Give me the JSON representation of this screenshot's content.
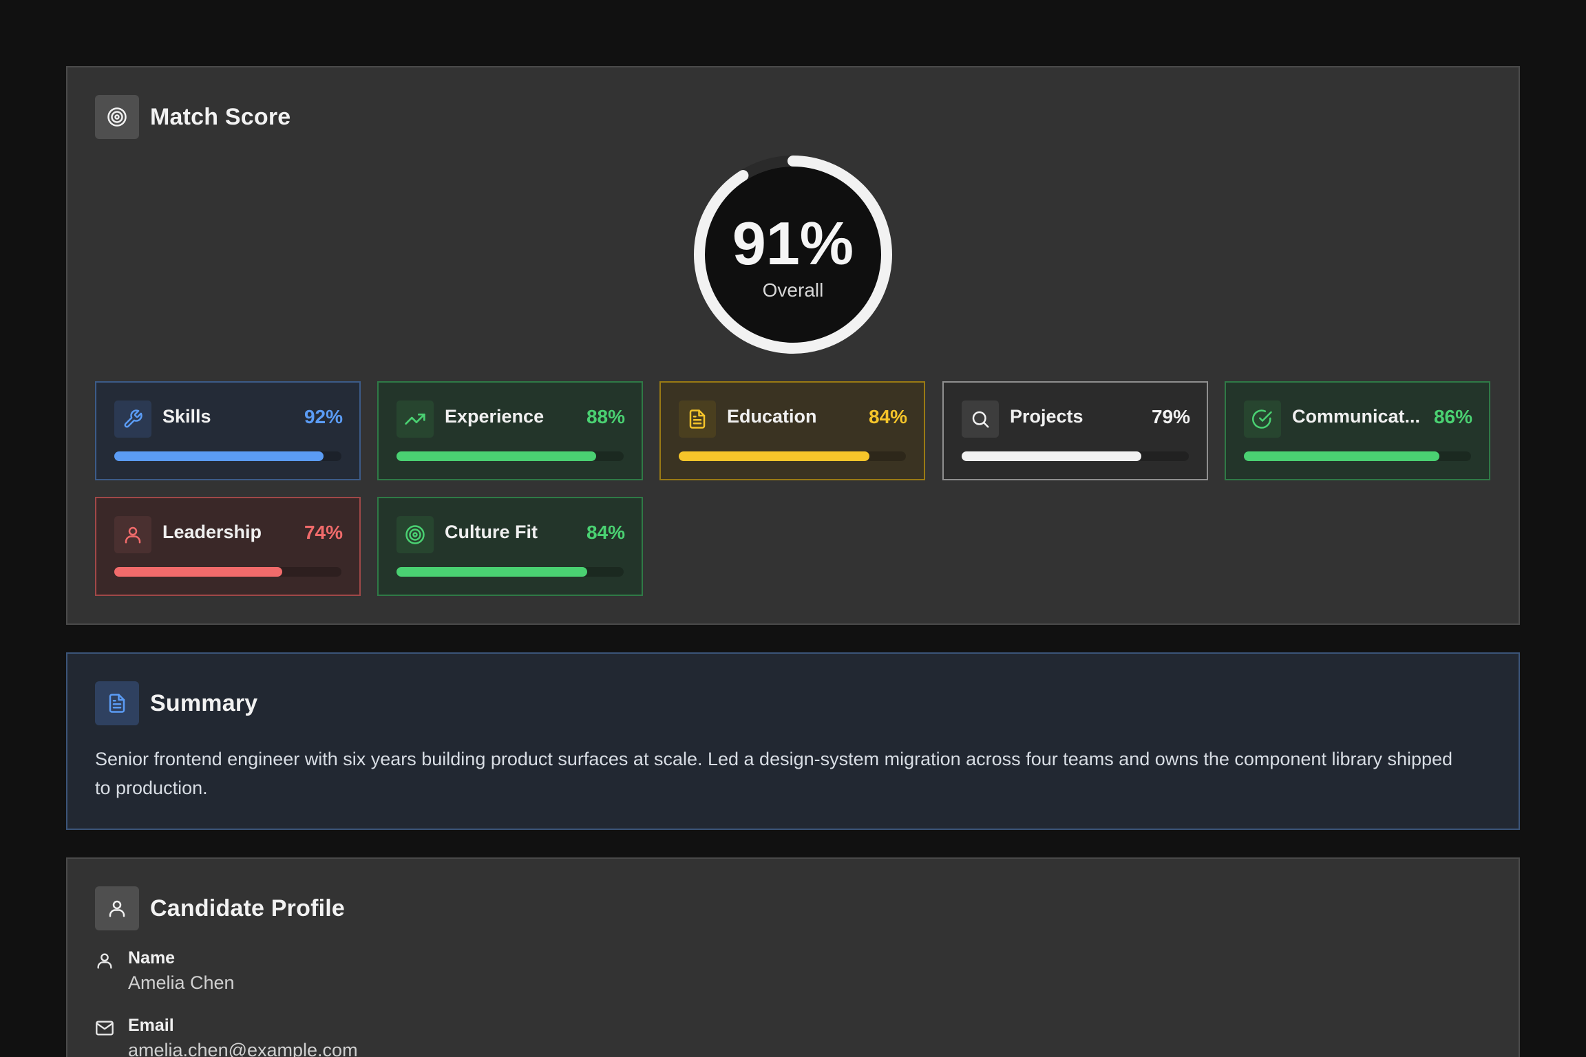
{
  "match_score": {
    "title": "Match Score",
    "overall_value": "91%",
    "overall_fraction": 0.91,
    "overall_label": "Overall",
    "metrics": [
      {
        "label": "Skills",
        "value": "92%",
        "fraction": 0.92,
        "icon": "wrench-icon",
        "color": "#5b9cf5"
      },
      {
        "label": "Experience",
        "value": "88%",
        "fraction": 0.88,
        "icon": "trending-up-icon",
        "color": "#4ad172"
      },
      {
        "label": "Education",
        "value": "84%",
        "fraction": 0.84,
        "icon": "document-icon",
        "color": "#f6c52a"
      },
      {
        "label": "Projects",
        "value": "79%",
        "fraction": 0.79,
        "icon": "search-icon",
        "color": "#f2f2f2"
      },
      {
        "label": "Communicat...",
        "value": "86%",
        "fraction": 0.86,
        "icon": "check-circle-icon",
        "color": "#4ad172"
      },
      {
        "label": "Leadership",
        "value": "74%",
        "fraction": 0.74,
        "icon": "user-icon",
        "color": "#f16b6b"
      },
      {
        "label": "Culture Fit",
        "value": "84%",
        "fraction": 0.84,
        "icon": "target-icon",
        "color": "#4ad172"
      }
    ]
  },
  "summary": {
    "title": "Summary",
    "text": "Senior frontend engineer with six years building product surfaces at scale. Led a design-system migration across four teams and owns the component library shipped to production."
  },
  "profile": {
    "title": "Candidate Profile",
    "fields": [
      {
        "label": "Name",
        "value": "Amelia Chen",
        "icon": "user-icon"
      },
      {
        "label": "Email",
        "value": "amelia.chen@example.com",
        "icon": "mail-icon"
      }
    ]
  }
}
